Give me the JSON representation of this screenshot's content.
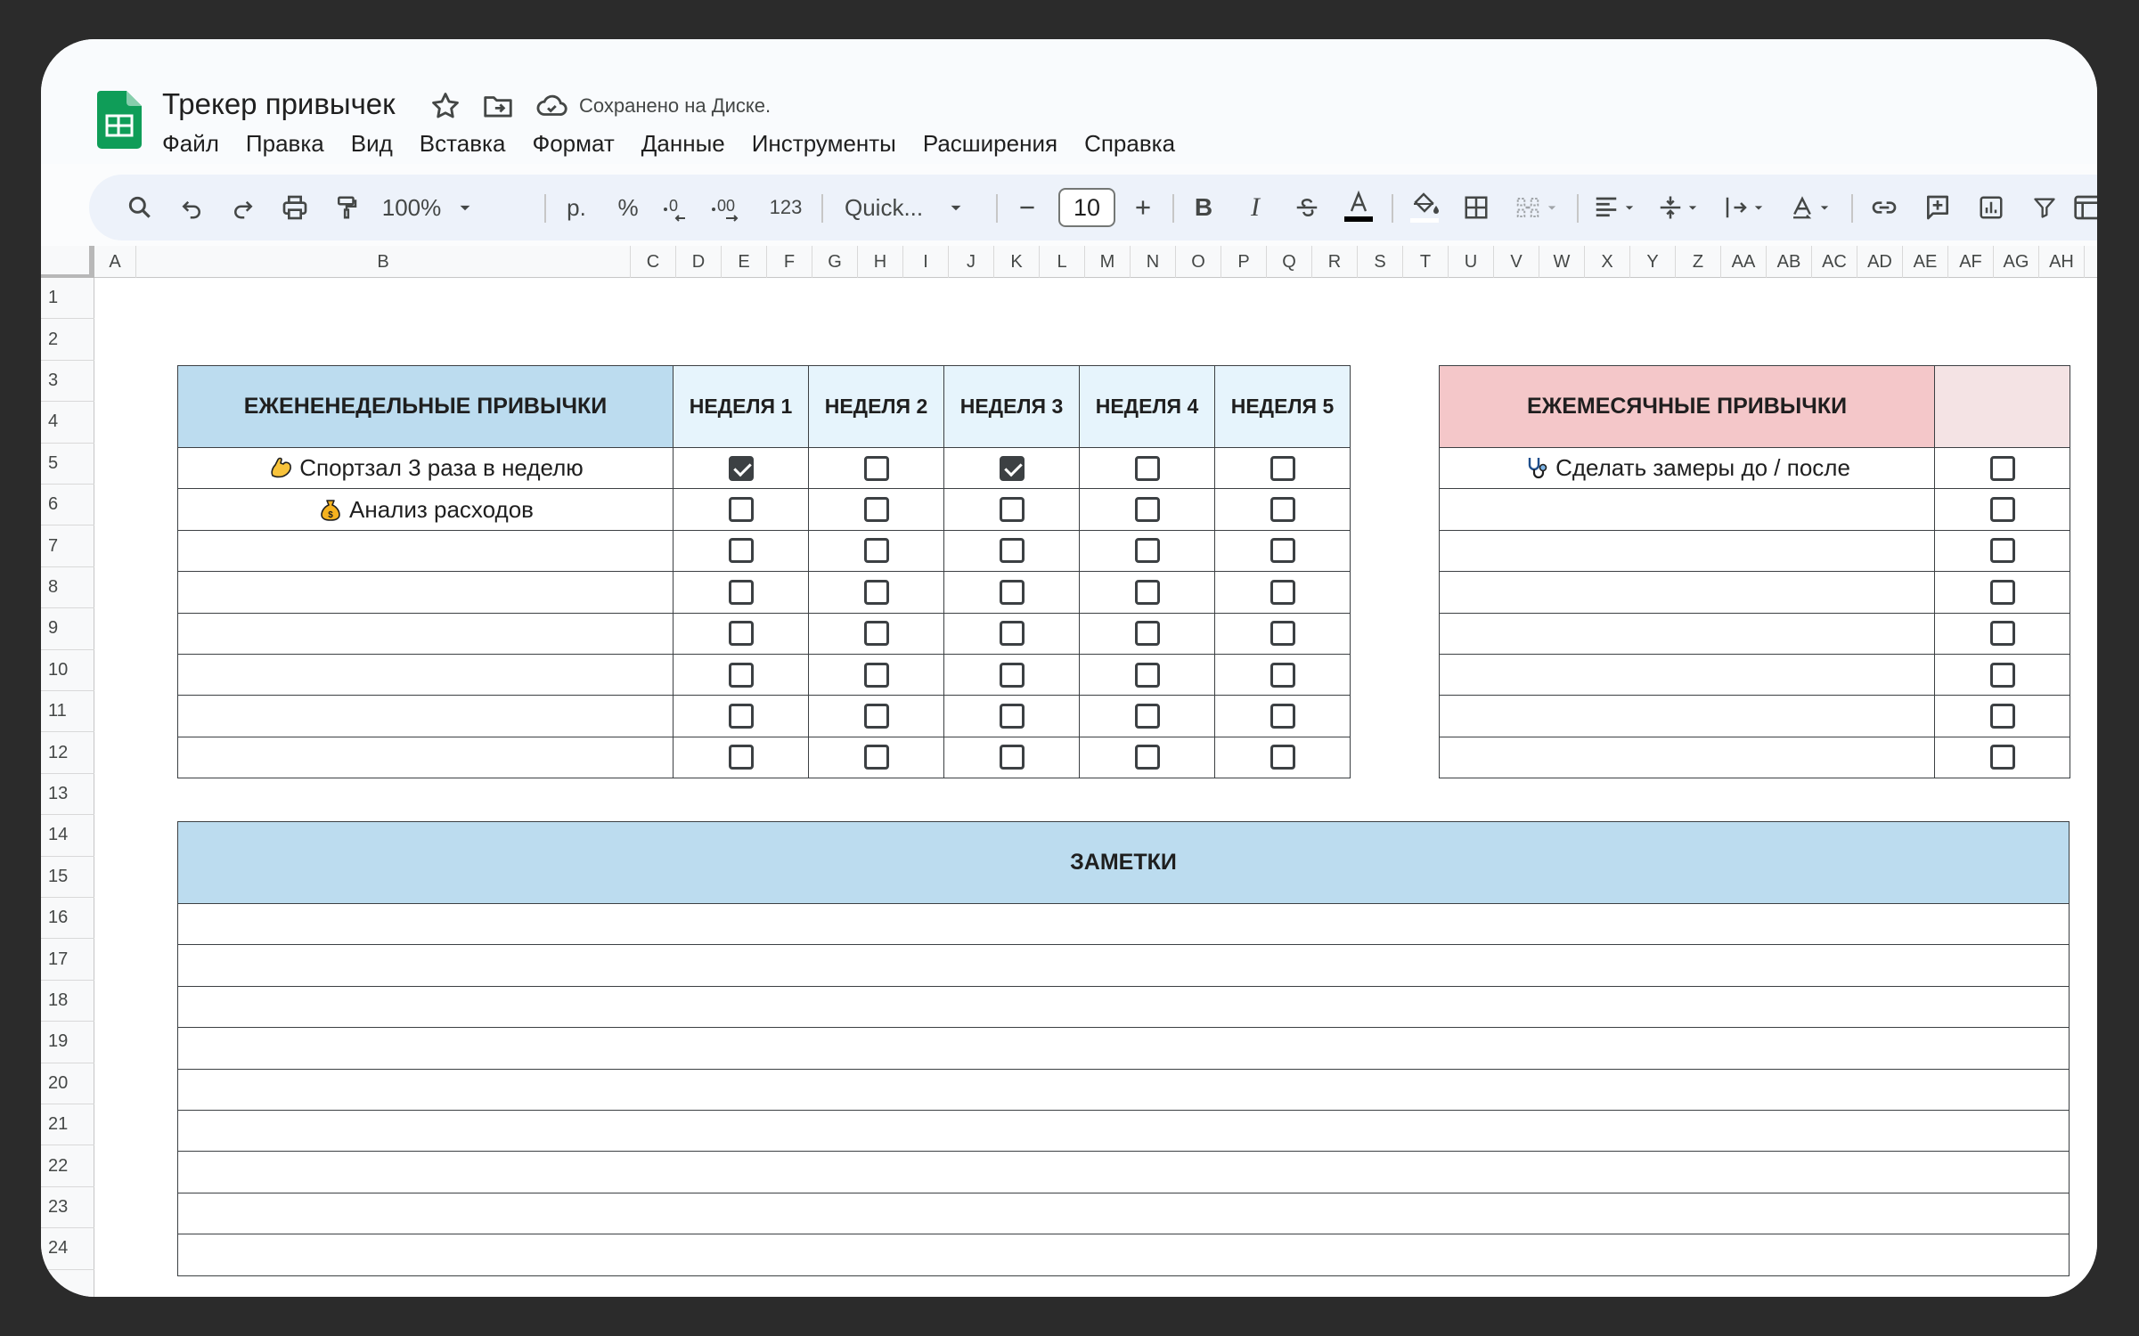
{
  "doc": {
    "title": "Трекер привычек",
    "save_status": "Сохранено на Диске."
  },
  "menu": [
    "Файл",
    "Правка",
    "Вид",
    "Вставка",
    "Формат",
    "Данные",
    "Инструменты",
    "Расширения",
    "Справка"
  ],
  "toolbar": {
    "zoom": "100%",
    "currency": "р.",
    "percent": "%",
    "decimal_decrease": ".0",
    "decimal_increase": ".00",
    "number_format": "123",
    "font": "Quick...",
    "font_size": "10",
    "bold": "B",
    "italic": "I"
  },
  "columns": [
    "A",
    "B",
    "C",
    "D",
    "E",
    "F",
    "G",
    "H",
    "I",
    "J",
    "K",
    "L",
    "M",
    "N",
    "O",
    "P",
    "Q",
    "R",
    "S",
    "T",
    "U",
    "V",
    "W",
    "X",
    "Y",
    "Z",
    "AA",
    "AB",
    "AC",
    "AD",
    "AE",
    "AF",
    "AG",
    "AH"
  ],
  "rows": [
    "1",
    "2",
    "3",
    "4",
    "5",
    "6",
    "7",
    "8",
    "9",
    "10",
    "11",
    "12",
    "13",
    "14",
    "15",
    "16",
    "17",
    "18",
    "19",
    "20",
    "21",
    "22",
    "23",
    "24"
  ],
  "weekly": {
    "header": "ЕЖЕНЕНЕДЕЛЬНЫЕ ПРИВЫЧКИ",
    "weeks": [
      "НЕДЕЛЯ 1",
      "НЕДЕЛЯ 2",
      "НЕДЕЛЯ 3",
      "НЕДЕЛЯ 4",
      "НЕДЕЛЯ 5"
    ],
    "habits": [
      {
        "emoji": "flexed-biceps-icon",
        "label": "Спортзал 3 раза в неделю",
        "checks": [
          true,
          false,
          true,
          false,
          false
        ]
      },
      {
        "emoji": "money-bag-icon",
        "label": "Анализ расходов",
        "checks": [
          false,
          false,
          false,
          false,
          false
        ]
      },
      {
        "label": "",
        "checks": [
          false,
          false,
          false,
          false,
          false
        ]
      },
      {
        "label": "",
        "checks": [
          false,
          false,
          false,
          false,
          false
        ]
      },
      {
        "label": "",
        "checks": [
          false,
          false,
          false,
          false,
          false
        ]
      },
      {
        "label": "",
        "checks": [
          false,
          false,
          false,
          false,
          false
        ]
      },
      {
        "label": "",
        "checks": [
          false,
          false,
          false,
          false,
          false
        ]
      },
      {
        "label": "",
        "checks": [
          false,
          false,
          false,
          false,
          false
        ]
      }
    ]
  },
  "monthly": {
    "header": "ЕЖЕМЕСЯЧНЫЕ ПРИВЫЧКИ",
    "habits": [
      {
        "emoji": "stethoscope-icon",
        "label": "Сделать замеры до / после",
        "checked": false
      },
      {
        "label": "",
        "checked": false
      },
      {
        "label": "",
        "checked": false
      },
      {
        "label": "",
        "checked": false
      },
      {
        "label": "",
        "checked": false
      },
      {
        "label": "",
        "checked": false
      },
      {
        "label": "",
        "checked": false
      },
      {
        "label": "",
        "checked": false
      }
    ]
  },
  "notes": {
    "header": "ЗАМЕТКИ",
    "lines": [
      "",
      "",
      "",
      "",
      "",
      "",
      "",
      "",
      ""
    ]
  },
  "colors": {
    "weekly_header_bg": "#bcdcef",
    "week_header_bg": "#e6f4fc",
    "monthly_header_bg": "#f4c7c9",
    "notes_header_bg": "#bcdcef",
    "sheets_green": "#0f9d58"
  }
}
